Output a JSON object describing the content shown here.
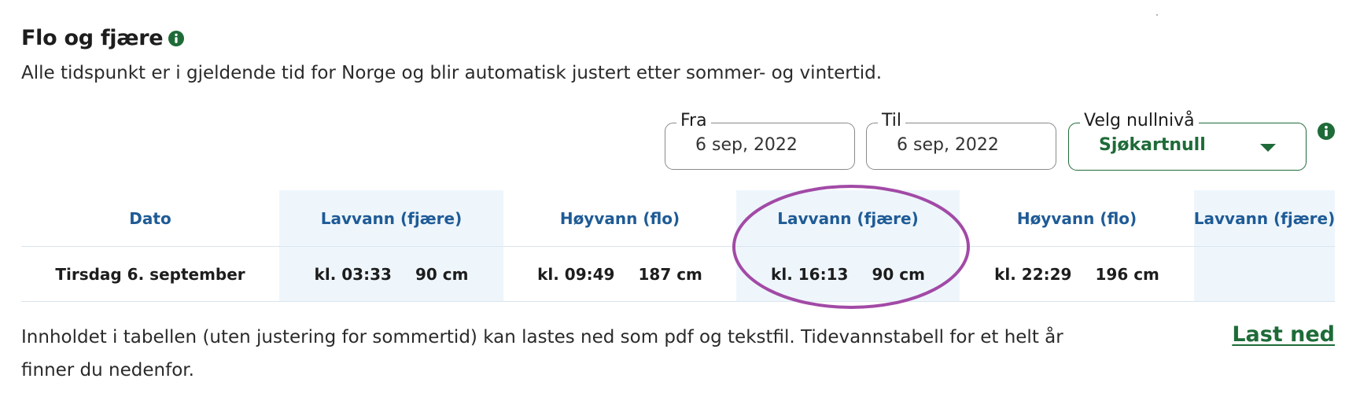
{
  "section": {
    "title": "Flo og fjære",
    "subtitle": "Alle tidspunkt er i gjeldende tid for Norge og blir automatisk justert etter sommer- og vintertid."
  },
  "filters": {
    "from": {
      "legend": "Fra",
      "value": "6 sep, 2022"
    },
    "to": {
      "legend": "Til",
      "value": "6 sep, 2022"
    },
    "zero_level": {
      "legend": "Velg nullnivå",
      "value": "Sjøkartnull"
    }
  },
  "table": {
    "headers": [
      "Dato",
      "Lavvann (fjære)",
      "Høyvann (flo)",
      "Lavvann (fjære)",
      "Høyvann (flo)",
      "Lavvann (fjære)"
    ],
    "rows": [
      {
        "date": "Tirsdag 6. september",
        "cells": [
          {
            "time": "kl. 03:33",
            "height": "90 cm"
          },
          {
            "time": "kl. 09:49",
            "height": "187 cm"
          },
          {
            "time": "kl. 16:13",
            "height": "90 cm"
          },
          {
            "time": "kl. 22:29",
            "height": "196 cm"
          },
          {
            "time": "",
            "height": ""
          }
        ]
      }
    ]
  },
  "footer": {
    "text": "Innholdet i tabellen (uten justering for sommertid) kan lastes ned som pdf og tekstfil. Tidevannstabell for et helt år finner du nedenfor.",
    "download_label": "Last ned"
  },
  "colors": {
    "brand_green": "#1e6b38",
    "header_blue": "#1f5b96",
    "shaded_column": "#eef6fc",
    "highlight_ellipse": "#a24aa6"
  },
  "icons": {
    "info": "info-circle-icon",
    "dropdown": "caret-down-icon"
  }
}
